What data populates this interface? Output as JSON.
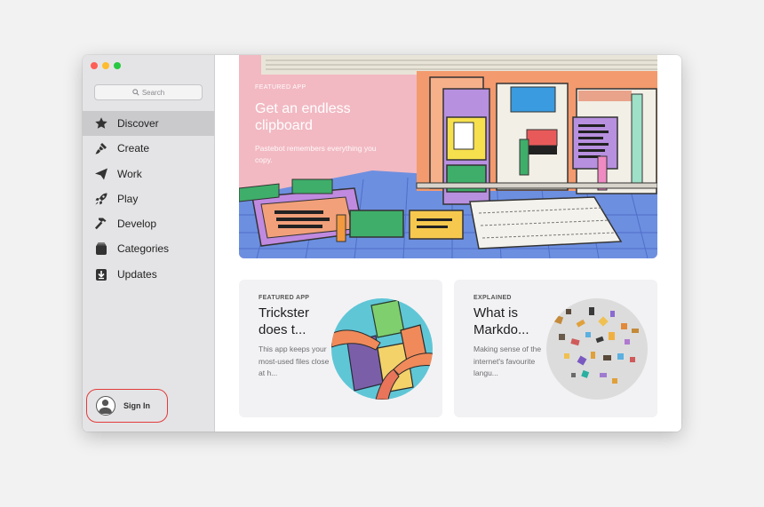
{
  "search": {
    "placeholder": "Search"
  },
  "sidebar": {
    "items": [
      {
        "label": "Discover",
        "icon": "star-icon",
        "active": true
      },
      {
        "label": "Create",
        "icon": "brush-icon"
      },
      {
        "label": "Work",
        "icon": "paper-plane-icon"
      },
      {
        "label": "Play",
        "icon": "rocket-icon"
      },
      {
        "label": "Develop",
        "icon": "hammer-icon"
      },
      {
        "label": "Categories",
        "icon": "categories-icon"
      },
      {
        "label": "Updates",
        "icon": "download-icon"
      }
    ],
    "sign_in": "Sign In"
  },
  "hero": {
    "eyebrow": "FEATURED APP",
    "title": "Get an endless clipboard",
    "subtitle": "Pastebot remembers everything you copy."
  },
  "cards": [
    {
      "eyebrow": "FEATURED APP",
      "title": "Trickster does t...",
      "description": "This app keeps your most-used files close at h..."
    },
    {
      "eyebrow": "EXPLAINED",
      "title": "What is Markdo...",
      "description": "Making sense of the internet's favourite langu..."
    }
  ],
  "colors": {
    "accent_red": "#e23b3b",
    "hero_bg": "#f2b9c2",
    "sidebar_bg": "#e4e4e6"
  }
}
